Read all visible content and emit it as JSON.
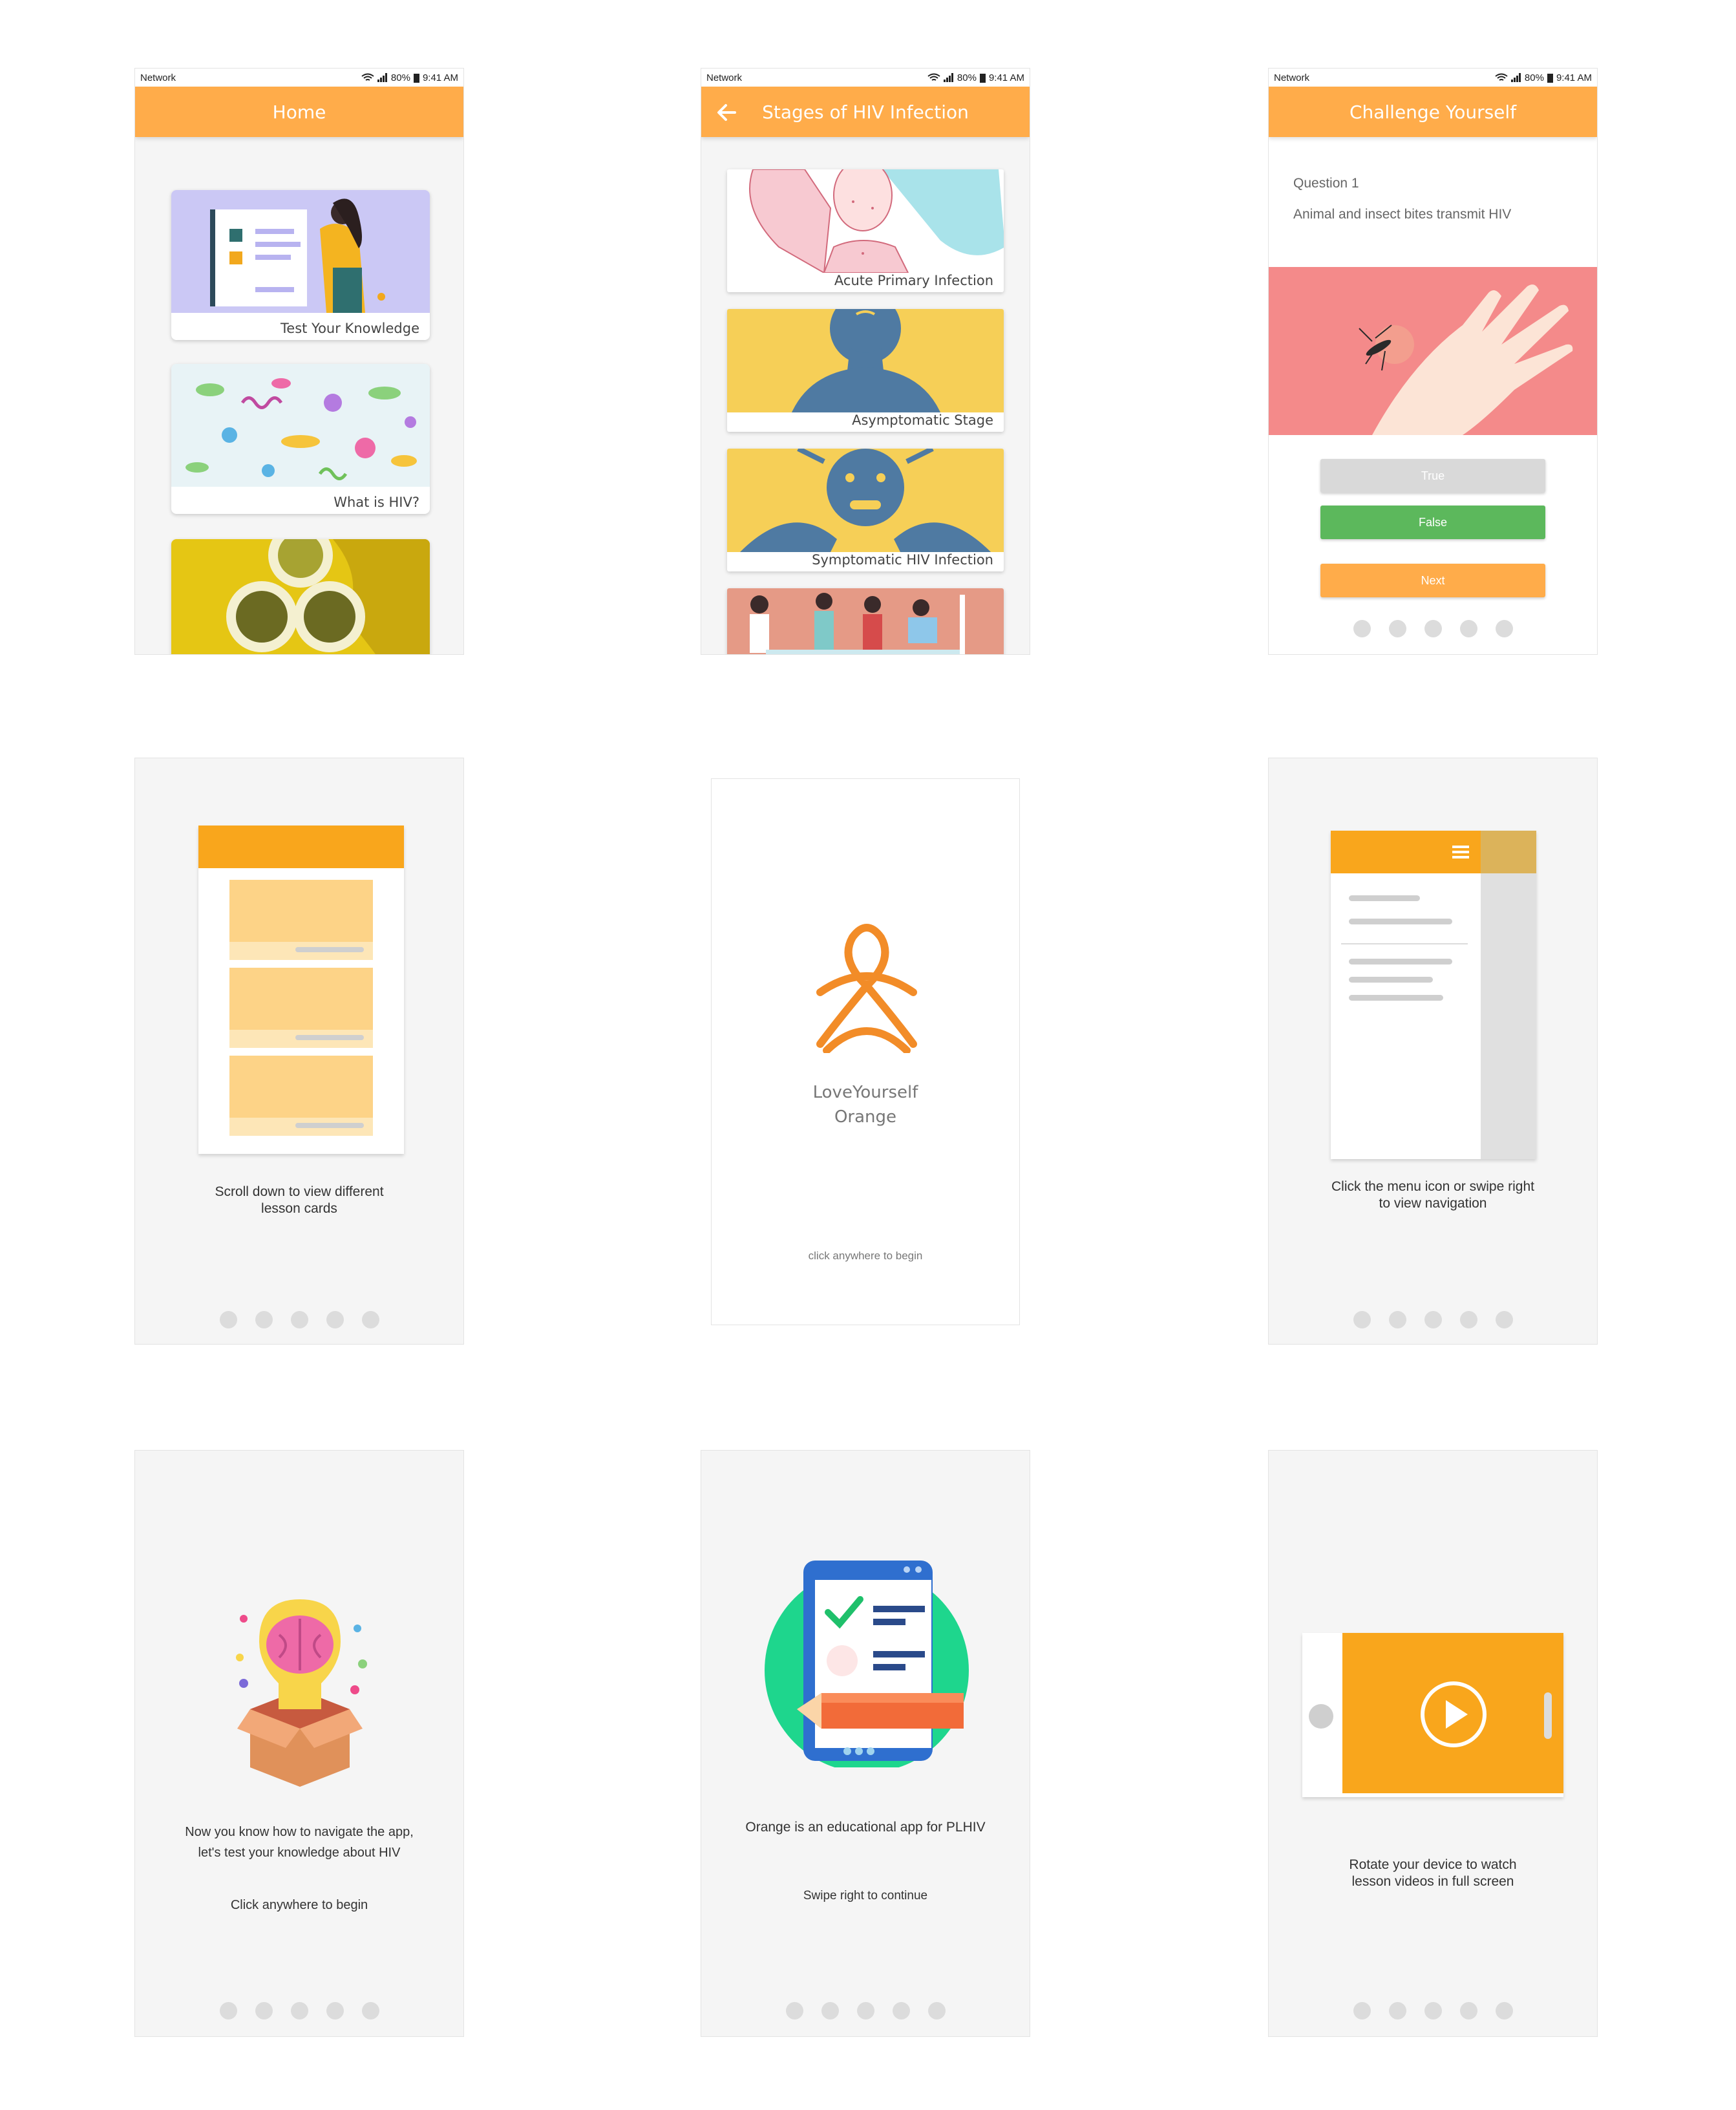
{
  "status_bar": {
    "network": "Network",
    "battery": "80%",
    "time": "9:41 AM"
  },
  "home": {
    "title": "Home",
    "cards": [
      "Test Your Knowledge",
      "What is HIV?"
    ]
  },
  "stages": {
    "title": "Stages of HIV Infection",
    "cards": [
      "Acute Primary Infection",
      "Asymptomatic Stage",
      "Symptomatic HIV Infection"
    ]
  },
  "quiz": {
    "title": "Challenge Yourself",
    "question_number": "Question 1",
    "question_text": "Animal and insect bites transmit HIV",
    "true_label": "True",
    "false_label": "False",
    "next_label": "Next"
  },
  "onboarding_scroll": {
    "text_line1": "Scroll down to view different",
    "text_line2": "lesson cards"
  },
  "splash": {
    "brand_line1": "LoveYourself",
    "brand_line2": "Orange",
    "hint": "click anywhere to begin"
  },
  "onboarding_menu": {
    "text_line1": "Click the menu icon or swipe right",
    "text_line2": "to view navigation"
  },
  "onboarding_quiz": {
    "text_line1": "Now you know how to navigate the app,",
    "text_line2": "let's test your knowledge about HIV",
    "hint": "Click anywhere to begin"
  },
  "onboarding_intro": {
    "text": "Orange is an educational app for PLHIV",
    "hint": "Swipe right to continue"
  },
  "onboarding_video": {
    "text_line1": "Rotate your device to watch",
    "text_line2": "lesson videos in full screen"
  },
  "colors": {
    "accent": "#ffac4a",
    "accent_dark": "#f9a61c",
    "success": "#5cb85c",
    "disabled": "#d9d9d9"
  },
  "icons": [
    "wifi-icon",
    "signal-icon",
    "battery-icon",
    "back-arrow-icon",
    "hamburger-menu-icon",
    "play-icon",
    "loveyourself-logo"
  ]
}
